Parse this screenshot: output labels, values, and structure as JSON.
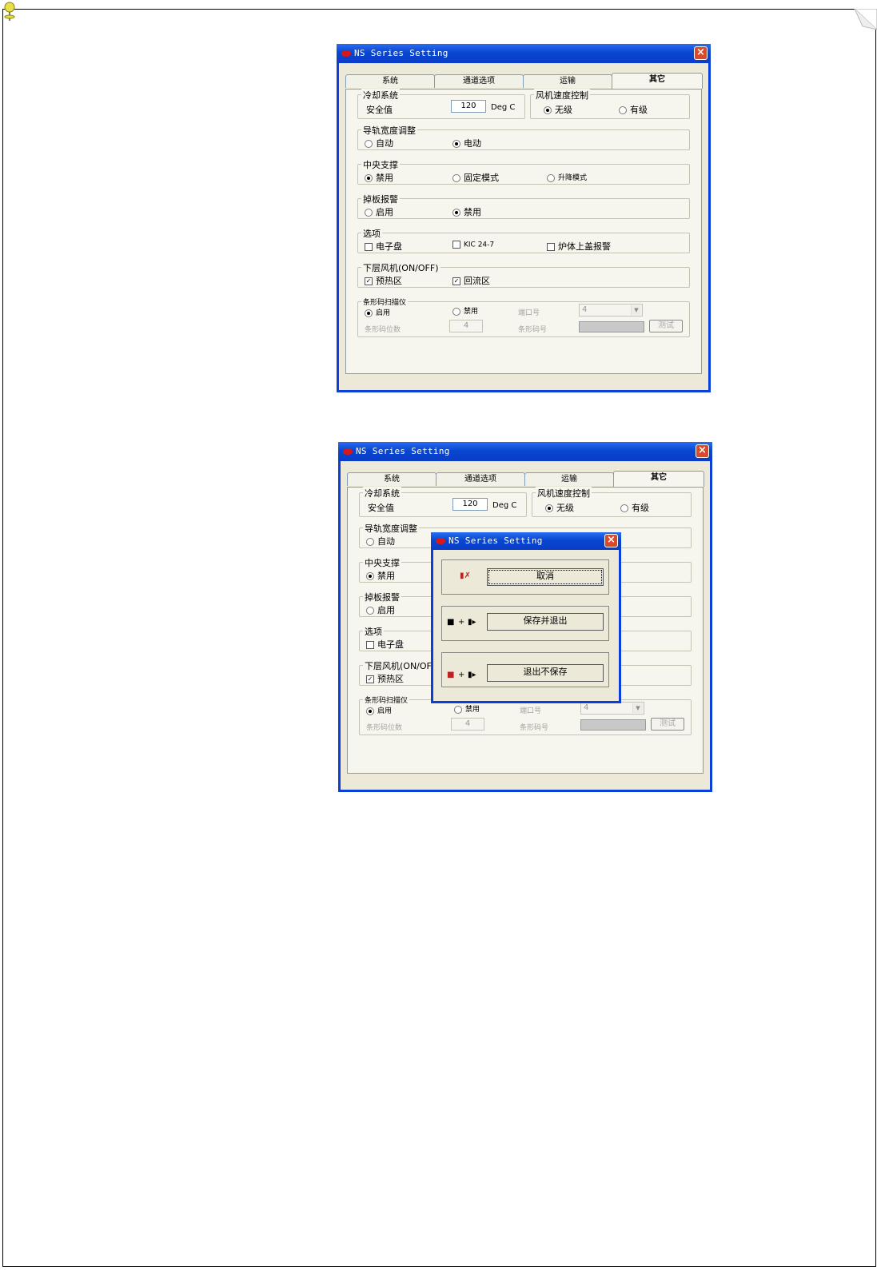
{
  "window_title": "NS Series Setting",
  "tabs": [
    "系统",
    "通道选项",
    "运输",
    "其它"
  ],
  "cooling": {
    "title": "冷却系统",
    "safe_label": "安全值",
    "safe_value": "120",
    "unit": "Deg C"
  },
  "fan_speed": {
    "title": "风机速度控制",
    "opt1": "无级",
    "opt2": "有级"
  },
  "rail": {
    "title": "导轨宽度调整",
    "opt1": "自动",
    "opt2": "电动"
  },
  "center": {
    "title": "中央支撑",
    "opt1": "禁用",
    "opt2": "固定模式",
    "opt3": "升降模式"
  },
  "drop": {
    "title": "掉板报警",
    "opt1": "启用",
    "opt2": "禁用"
  },
  "options": {
    "title": "选项",
    "opt1": "电子盘",
    "opt2": "KIC 24-7",
    "opt3": "炉体上盖报警"
  },
  "lower_fan": {
    "title": "下层风机(ON/OFF)",
    "title_cut": "下层风机(ON/OF",
    "opt1": "预热区",
    "opt2": "回流区",
    "check1": "✓",
    "check2": "✓"
  },
  "barcode": {
    "title": "条形码扫描仪",
    "enable": "启用",
    "disable": "禁用",
    "port_label": "端口号",
    "port_value": "4",
    "digits_label": "条形码位数",
    "digits_value": "4",
    "code_label": "条形码号",
    "test_btn": "测试"
  },
  "dialog": {
    "title": "NS Series Setting",
    "cancel": "取消",
    "save_exit": "保存并退出",
    "exit_nosave": "退出不保存",
    "plus": "+"
  },
  "colors": {
    "title_blue": "#0a3fd9",
    "face": "#ece9d8",
    "close_red": "#d94a2a"
  }
}
